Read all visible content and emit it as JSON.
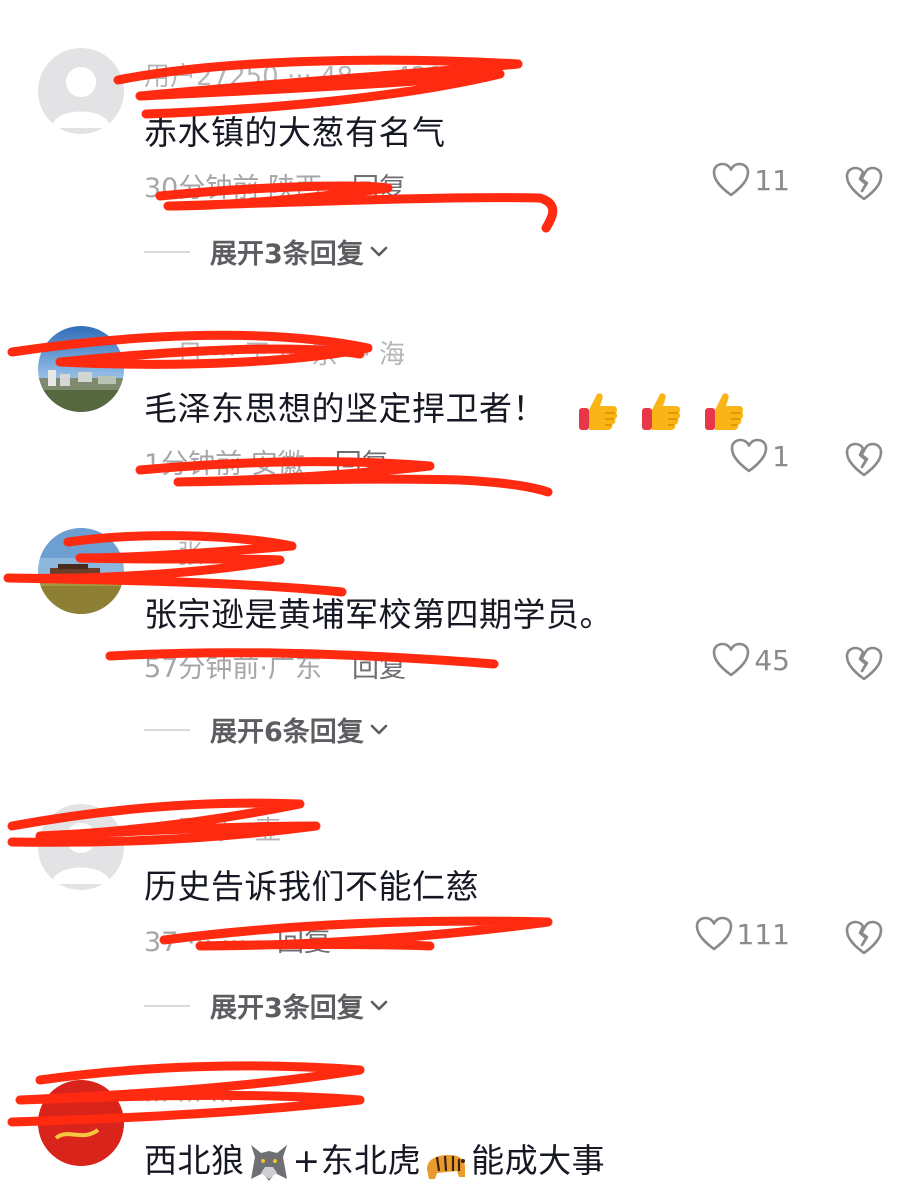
{
  "colors": {
    "text_primary": "#161823",
    "text_meta": "#a6a6aa",
    "redaction": "#ff2a10"
  },
  "icons": {
    "like": "heart-outline-icon",
    "dislike": "broken-heart-icon",
    "expand": "chevron-down-icon",
    "thumbs_up": "thumbs-up-emoji",
    "wolf": "wolf-emoji",
    "tiger": "tiger-emoji"
  },
  "comments": [
    {
      "username": "用户27250 ··· 48 ··· 429",
      "content": "赤水镇的大葱有名气",
      "time_location": "30分钟前·陕西",
      "reply": "回复",
      "likes": "11",
      "expand": "展开3条回复"
    },
    {
      "username": "··· 日 ··· 王 ··· 京 ··· 海",
      "content": "毛泽东思想的坚定捍卫者！",
      "time_location": "1分钟前·安徽",
      "reply": "回复",
      "likes": "1"
    },
    {
      "username": "··· 张 ···",
      "content": "张宗逊是黄埔军校第四期学员。",
      "time_location": "57分钟前·广东",
      "reply": "回复",
      "likes": "45",
      "expand": "展开6条回复"
    },
    {
      "username": "··· 愿得一壶",
      "content": "历史告诉我们不能仁慈",
      "time_location": "37 ··· ···",
      "reply": "回复",
      "likes": "111",
      "expand": "展开3条回复"
    },
    {
      "username": "··· ··· ···",
      "content_a": "西北狼",
      "content_b": "+东北虎",
      "content_c": "能成大事"
    }
  ]
}
